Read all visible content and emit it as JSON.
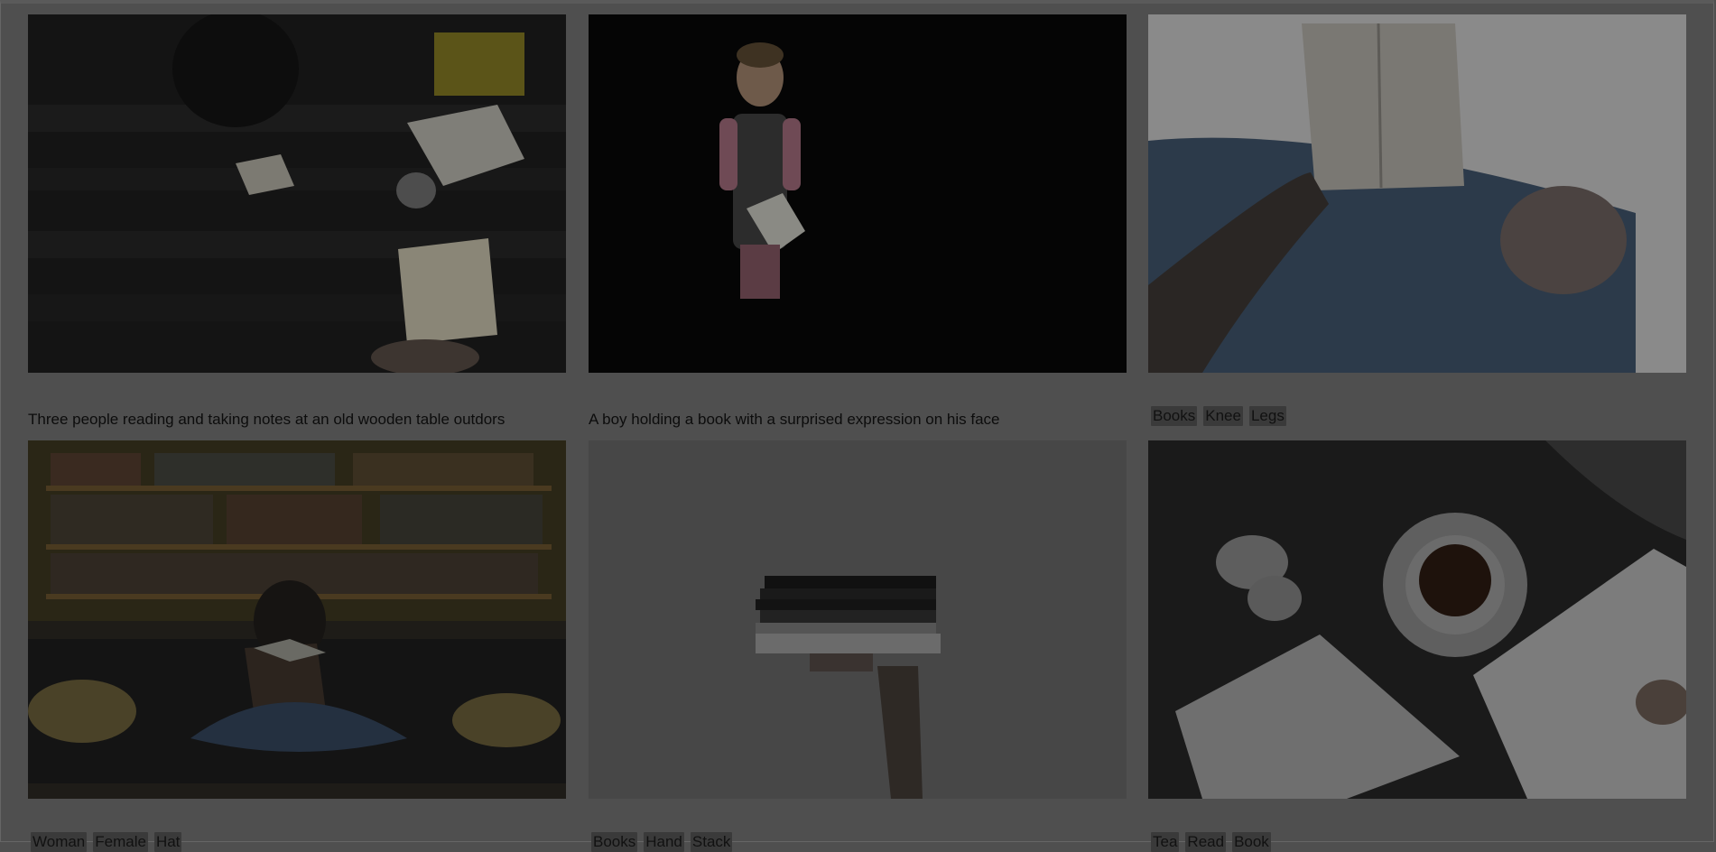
{
  "gallery": {
    "items": [
      {
        "caption": "Three people reading and taking notes at an old wooden table outdors",
        "tags": []
      },
      {
        "caption": "A boy holding a book with a surprised expression on his face",
        "tags": []
      },
      {
        "caption": "",
        "tags": [
          "Books",
          "Knee",
          "Legs"
        ]
      },
      {
        "caption": "",
        "tags": [
          "Woman",
          "Female",
          "Hat"
        ]
      },
      {
        "caption": "",
        "tags": [
          "Books",
          "Hand",
          "Stack"
        ]
      },
      {
        "caption": "",
        "tags": [
          "Tea",
          "Read",
          "Book"
        ]
      }
    ]
  },
  "colors": {
    "overlay": "#4f4f4f",
    "tag_bg": "#3a3a3a",
    "text": "#0c0c0c"
  }
}
